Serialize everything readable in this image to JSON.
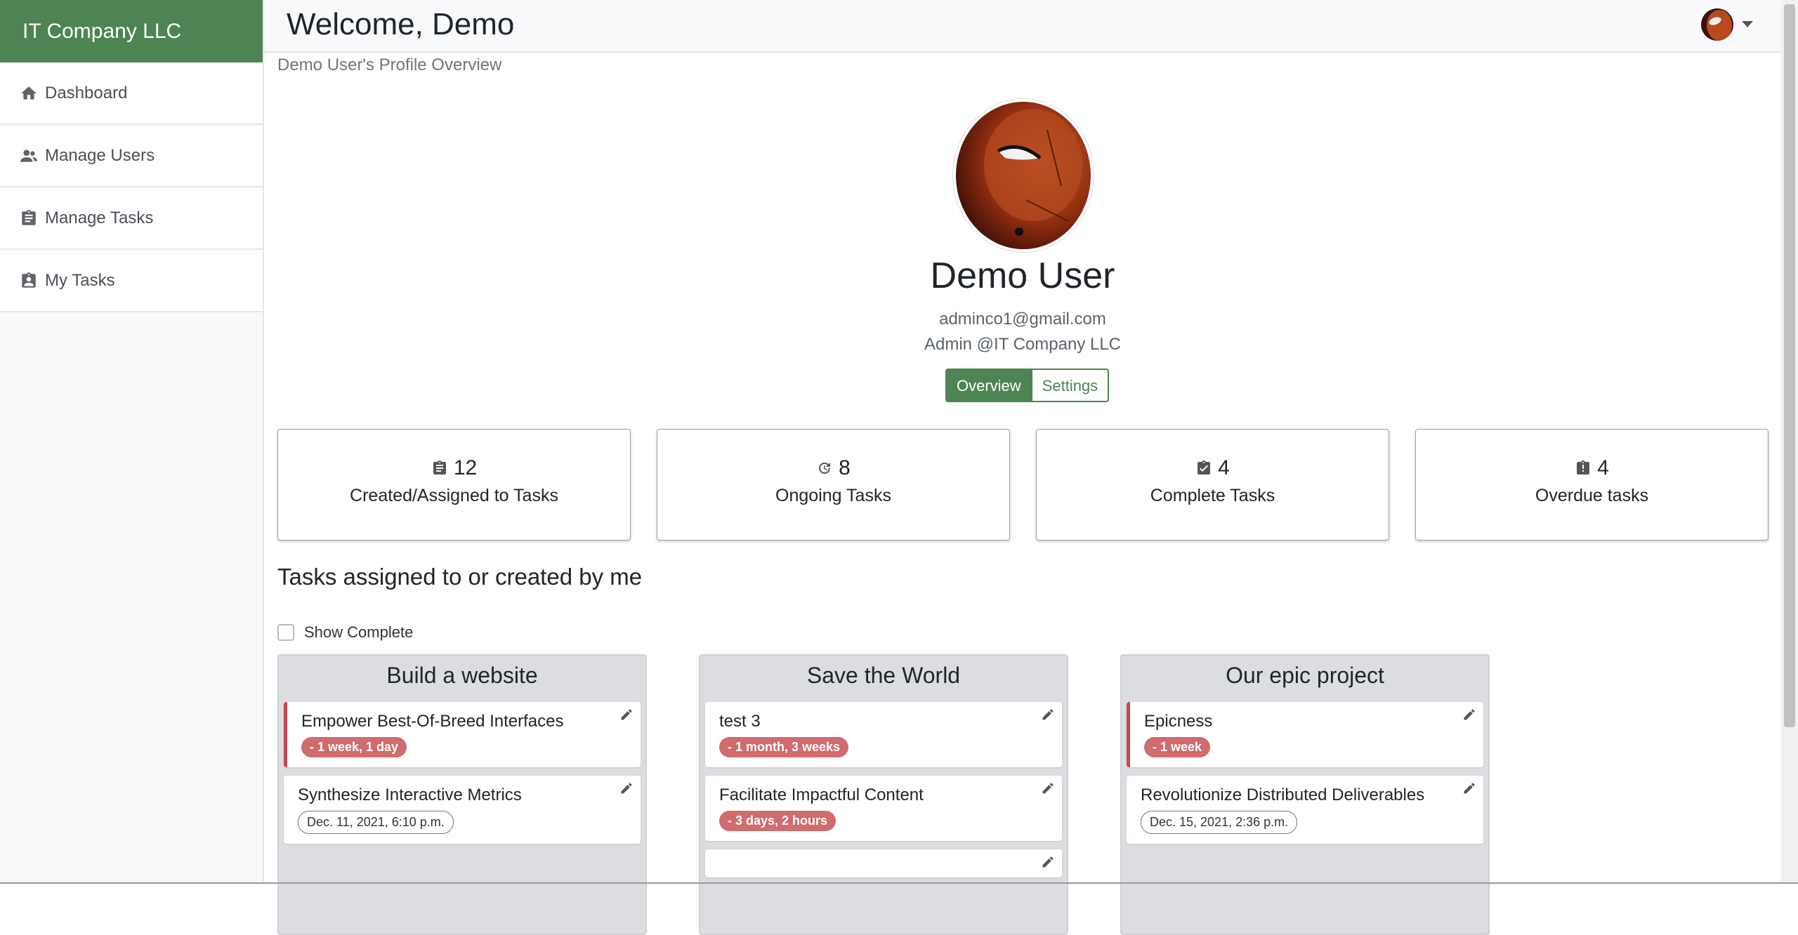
{
  "sidebar": {
    "brand": "IT Company LLC",
    "items": [
      {
        "label": "Dashboard",
        "icon": "home-icon"
      },
      {
        "label": "Manage Users",
        "icon": "users-icon"
      },
      {
        "label": "Manage Tasks",
        "icon": "clipboard-icon"
      },
      {
        "label": "My Tasks",
        "icon": "clipboard-user-icon"
      }
    ]
  },
  "header": {
    "welcome": "Welcome, Demo"
  },
  "profile": {
    "overview_label": "Demo User's Profile Overview",
    "name": "Demo User",
    "email": "adminco1@gmail.com",
    "role": "Admin @IT Company LLC",
    "tabs": {
      "overview": "Overview",
      "settings": "Settings"
    }
  },
  "stats": [
    {
      "value": "12",
      "label": "Created/Assigned to Tasks",
      "icon": "clipboard-icon"
    },
    {
      "value": "8",
      "label": "Ongoing Tasks",
      "icon": "refresh-clock-icon"
    },
    {
      "value": "4",
      "label": "Complete Tasks",
      "icon": "clipboard-check-icon"
    },
    {
      "value": "4",
      "label": "Overdue tasks",
      "icon": "clipboard-alert-icon"
    }
  ],
  "tasks_section": {
    "title": "Tasks assigned to or created by me",
    "show_complete_label": "Show Complete"
  },
  "projects": [
    {
      "title": "Build a website",
      "tasks": [
        {
          "title": "Empower Best-Of-Breed Interfaces",
          "badge": "- 1 week, 1 day",
          "badge_type": "overdue"
        },
        {
          "title": "Synthesize Interactive Metrics",
          "badge": "Dec. 11, 2021, 6:10 p.m.",
          "badge_type": "date"
        }
      ]
    },
    {
      "title": "Save the World",
      "tasks": [
        {
          "title": "test 3",
          "badge": "- 1 month, 3 weeks",
          "badge_type": "overdue"
        },
        {
          "title": "Facilitate Impactful Content",
          "badge": "- 3 days, 2 hours",
          "badge_type": "overdue"
        }
      ]
    },
    {
      "title": "Our epic project",
      "tasks": [
        {
          "title": "Epicness",
          "badge": "- 1 week",
          "badge_type": "overdue"
        },
        {
          "title": "Revolutionize Distributed Deliverables",
          "badge": "Dec. 15, 2021, 2:36 p.m.",
          "badge_type": "date"
        }
      ]
    }
  ],
  "colors": {
    "brand": "#4e8453",
    "overdue_badge": "#d06b6e",
    "urgent_border": "#c9474f"
  }
}
